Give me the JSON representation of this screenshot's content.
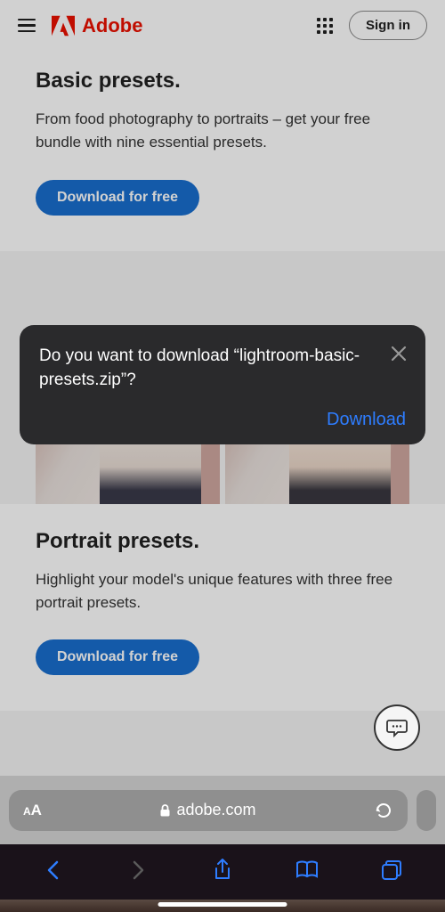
{
  "header": {
    "brand": "Adobe",
    "signin_label": "Sign in"
  },
  "sections": [
    {
      "title": "Basic presets.",
      "body": "From food photography to portraits – get your free bundle with nine essential presets.",
      "cta": "Download for free"
    },
    {
      "title": "Portrait presets.",
      "body": "Highlight your model's unique features with three free portrait presets.",
      "cta": "Download for free"
    }
  ],
  "dialog": {
    "message": "Do you want to download “lightroom-basic-presets.zip”?",
    "action": "Download"
  },
  "browser": {
    "domain": "adobe.com"
  }
}
